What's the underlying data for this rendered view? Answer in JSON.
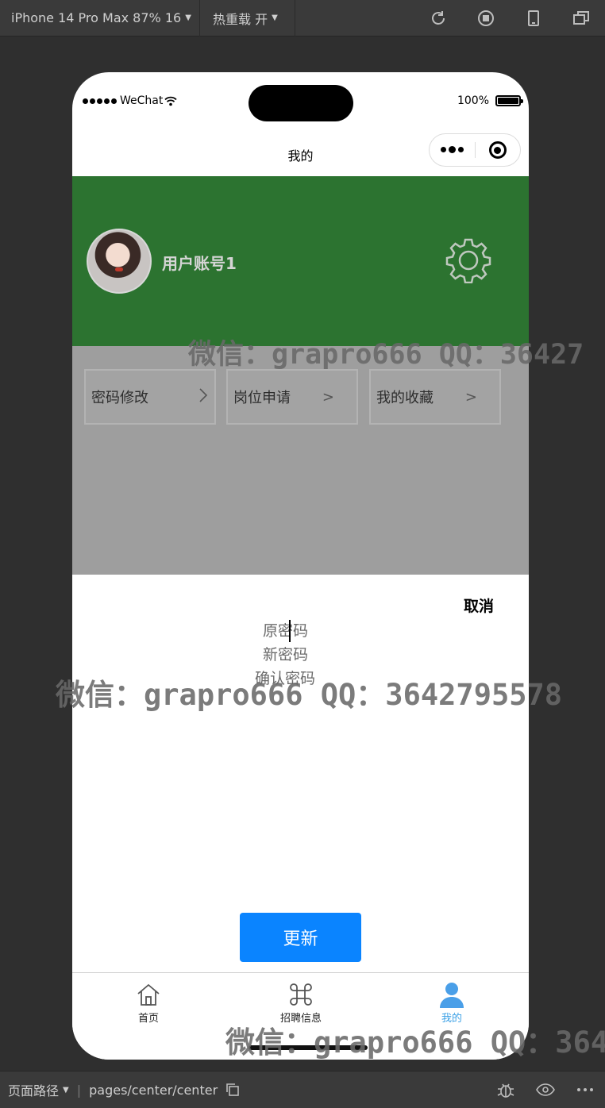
{
  "devtools": {
    "device_label": "iPhone 14 Pro Max 87% 16",
    "hot_reload_label": "热重载 开",
    "tools": [
      "refresh-icon",
      "stop-icon",
      "phone-icon",
      "window-icon"
    ],
    "path_label": "页面路径",
    "path_value": "pages/center/center",
    "bottom_tools": [
      "bug-icon",
      "eye-icon",
      "more-icon"
    ]
  },
  "status_bar": {
    "carrier": "WeChat",
    "battery": "100%"
  },
  "navbar": {
    "title": "我的"
  },
  "profile": {
    "username": "用户账号1"
  },
  "menu": [
    {
      "label": "密码修改",
      "arrow": ">"
    },
    {
      "label": "岗位申请",
      "arrow": ">"
    },
    {
      "label": "我的收藏",
      "arrow": ">"
    }
  ],
  "sheet": {
    "cancel_label": "取消",
    "old_password_placeholder": "原密码",
    "new_password_placeholder": "新密码",
    "confirm_password_placeholder": "确认密码",
    "update_label": "更新"
  },
  "tabbar": {
    "items": [
      {
        "label": "首页",
        "icon": "home-icon"
      },
      {
        "label": "招聘信息",
        "icon": "command-icon"
      },
      {
        "label": "我的",
        "icon": "user-icon"
      }
    ],
    "active_color": "#3aa0e6"
  },
  "watermark": {
    "text_long": "微信：grapro666 QQ：3642795578",
    "text_short": "微信：grapro666 QQ：36427"
  },
  "colors": {
    "header_green": "#2c7330",
    "overlay_gray": "#9e9e9e",
    "button_blue": "#0a84ff"
  }
}
